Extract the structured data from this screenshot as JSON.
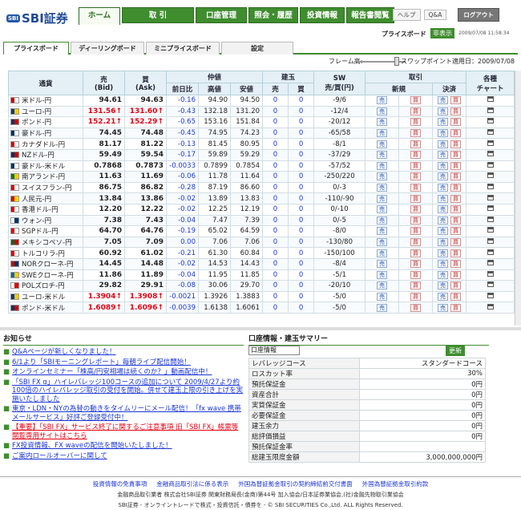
{
  "app": {
    "logo_mark": "SBI",
    "logo_text": "SBI証券"
  },
  "nav": [
    "ホーム",
    "取 引",
    "口座管理",
    "照会・履歴",
    "投資情報",
    "報告書閲覧"
  ],
  "utils": {
    "help": "ヘルプ",
    "qa": "Q&A",
    "logout": "ログアウト"
  },
  "info": {
    "label": "プライスボード",
    "badge": "非表示",
    "timestamp": "2009/07/08 11:58:34"
  },
  "subtabs": [
    "プライスボード",
    "ディーリングボード",
    "ミニプライスボード",
    "設定"
  ],
  "frame": {
    "label": "フレーム高:",
    "swap": "スワップポイント適用日：2009/07/08"
  },
  "board": {
    "headers": {
      "pair": "通貨",
      "bid": "売\n(Bid)",
      "ask": "買\n(Ask)",
      "mid": "仲値",
      "mid_sub": [
        "前日比",
        "高値",
        "安値"
      ],
      "pos": "建玉",
      "pos_sub": [
        "売",
        "買"
      ],
      "sw": "SW\n売/買(円)",
      "trade": "取引",
      "trade_sub": [
        "新規",
        "決済"
      ],
      "chart": "各種\nチャート"
    },
    "buy": "売",
    "sell": "買",
    "rows": [
      {
        "pair": "米ドル-円",
        "bid": "94.61",
        "ask": "94.63",
        "chg": "-0.16",
        "high": "94.90",
        "low": "94.50",
        "s": "0",
        "b": "0",
        "sw": "-9/6",
        "up": false,
        "flag": [
          "#c00",
          "#fff"
        ]
      },
      {
        "pair": "ユーロ-円",
        "bid": "131.56↑",
        "ask": "131.60↑",
        "chg": "-0.43",
        "high": "132.18",
        "low": "131.20",
        "s": "0",
        "b": "0",
        "sw": "-12/4",
        "up": true,
        "flag": [
          "#039",
          "#fc0"
        ]
      },
      {
        "pair": "ポンド-円",
        "bid": "152.21↑",
        "ask": "152.29↑",
        "chg": "-0.65",
        "high": "153.16",
        "low": "151.84",
        "s": "0",
        "b": "0",
        "sw": "-20/12",
        "up": true,
        "flag": [
          "#036",
          "#c00"
        ]
      },
      {
        "pair": "豪ドル-円",
        "bid": "74.45",
        "ask": "74.48",
        "chg": "-0.45",
        "high": "74.95",
        "low": "74.23",
        "s": "0",
        "b": "0",
        "sw": "-65/58",
        "up": false,
        "flag": [
          "#036",
          "#fff"
        ]
      },
      {
        "pair": "カナダドル-円",
        "bid": "81.17",
        "ask": "81.22",
        "chg": "-0.13",
        "high": "81.45",
        "low": "80.95",
        "s": "0",
        "b": "0",
        "sw": "-8/1",
        "up": false,
        "flag": [
          "#d00",
          "#fff"
        ]
      },
      {
        "pair": "NZドル-円",
        "bid": "59.49",
        "ask": "59.54",
        "chg": "-0.17",
        "high": "59.89",
        "low": "59.29",
        "s": "0",
        "b": "0",
        "sw": "-37/29",
        "up": false,
        "flag": [
          "#036",
          "#c00"
        ]
      },
      {
        "pair": "豪ドル-米ドル",
        "bid": "0.7868",
        "ask": "0.7873",
        "chg": "-0.0033",
        "high": "0.7899",
        "low": "0.7854",
        "s": "0",
        "b": "0",
        "sw": "-57/52",
        "up": false,
        "flag": [
          "#036",
          "#fff"
        ]
      },
      {
        "pair": "南アランド-円",
        "bid": "11.63",
        "ask": "11.69",
        "chg": "-0.06",
        "high": "11.78",
        "low": "11.64",
        "s": "0",
        "b": "0",
        "sw": "-250/220",
        "up": false,
        "flag": [
          "#073",
          "#fc0"
        ]
      },
      {
        "pair": "スイスフラン-円",
        "bid": "86.75",
        "ask": "86.82",
        "chg": "-0.28",
        "high": "87.19",
        "low": "86.60",
        "s": "0",
        "b": "0",
        "sw": "0/-3",
        "up": false,
        "flag": [
          "#d00",
          "#fff"
        ]
      },
      {
        "pair": "人民元-円",
        "bid": "13.84",
        "ask": "13.86",
        "chg": "-0.02",
        "high": "13.89",
        "low": "13.83",
        "s": "0",
        "b": "0",
        "sw": "-110/-90",
        "up": false,
        "flag": [
          "#d00",
          "#fd0"
        ]
      },
      {
        "pair": "香港ドル-円",
        "bid": "12.20",
        "ask": "12.22",
        "chg": "-0.02",
        "high": "12.25",
        "low": "12.19",
        "s": "0",
        "b": "0",
        "sw": "0/-10",
        "up": false,
        "flag": [
          "#d00",
          "#fff"
        ]
      },
      {
        "pair": "ウォン-円",
        "bid": "7.38",
        "ask": "7.43",
        "chg": "-0.04",
        "high": "7.47",
        "low": "7.39",
        "s": "0",
        "b": "0",
        "sw": "0/-5",
        "up": false,
        "flag": [
          "#fff",
          "#036"
        ]
      },
      {
        "pair": "SGPドル-円",
        "bid": "64.70",
        "ask": "64.76",
        "chg": "-0.19",
        "high": "65.02",
        "low": "64.59",
        "s": "0",
        "b": "0",
        "sw": "-8/0",
        "up": false,
        "flag": [
          "#d00",
          "#fff"
        ]
      },
      {
        "pair": "メキシコペソ-円",
        "bid": "7.05",
        "ask": "7.09",
        "chg": "0.00",
        "high": "7.06",
        "low": "7.06",
        "s": "0",
        "b": "0",
        "sw": "-130/80",
        "up": false,
        "flag": [
          "#063",
          "#c00"
        ]
      },
      {
        "pair": "トルコリラ-円",
        "bid": "60.92",
        "ask": "61.02",
        "chg": "-0.21",
        "high": "61.30",
        "low": "60.84",
        "s": "0",
        "b": "0",
        "sw": "-150/100",
        "up": false,
        "flag": [
          "#d00",
          "#fff"
        ]
      },
      {
        "pair": "NORクローネ-円",
        "bid": "14.45",
        "ask": "14.48",
        "chg": "-0.02",
        "high": "14.53",
        "low": "14.43",
        "s": "0",
        "b": "0",
        "sw": "-8/4",
        "up": false,
        "flag": [
          "#c00",
          "#036"
        ]
      },
      {
        "pair": "SWEクローネ-円",
        "bid": "11.86",
        "ask": "11.89",
        "chg": "-0.04",
        "high": "11.95",
        "low": "11.85",
        "s": "0",
        "b": "0",
        "sw": "-5/1",
        "up": false,
        "flag": [
          "#06a",
          "#fc0"
        ]
      },
      {
        "pair": "POLズロチ-円",
        "bid": "29.82",
        "ask": "29.91",
        "chg": "-0.08",
        "high": "30.06",
        "low": "29.70",
        "s": "0",
        "b": "0",
        "sw": "-20/10",
        "up": false,
        "flag": [
          "#fff",
          "#d00"
        ]
      },
      {
        "pair": "ユーロ-米ドル",
        "bid": "1.3904↑",
        "ask": "1.3908↑",
        "chg": "-0.0021",
        "high": "1.3926",
        "low": "1.3883",
        "s": "0",
        "b": "0",
        "sw": "-5/0",
        "up": true,
        "flag": [
          "#039",
          "#fc0"
        ]
      },
      {
        "pair": "ポンド-米ドル",
        "bid": "1.6089↑",
        "ask": "1.6096↑",
        "chg": "-0.0039",
        "high": "1.6138",
        "low": "1.6061",
        "s": "0",
        "b": "0",
        "sw": "-5/0",
        "up": true,
        "flag": [
          "#036",
          "#c00"
        ]
      }
    ]
  },
  "news": {
    "title": "お知らせ",
    "items": [
      {
        "text": "Q&Aページが新しくなりました！",
        "red": false
      },
      {
        "text": "6/1より「SBIモーニングレポート」毎朝ライブ配信開始！",
        "red": false
      },
      {
        "text": "オンラインセミナー「株高/円安相場は続くのか？」動画配信中！",
        "red": false
      },
      {
        "text": "「SBI FX α」ハイレバレッジ100コースの追加について 2009/4/27より約100倍のハイレバレッジ取引の受付を開始。併せて建玉上限の引き上げを実施いたしました",
        "red": false
      },
      {
        "text": "東京・LDN・NYの為替の動きをタイムリーにメール配信！「fx wave 携帯メールサービス」好評ご登録受付中！",
        "red": false
      },
      {
        "text": "【重要】「SBI FX」サービス終了に関するご注意事項 旧「SBI FX」帳票等閲覧専用サイトはこちら",
        "red": true
      },
      {
        "text": "FX投資情報、FX waveの配信を開始いたしました！",
        "red": false
      },
      {
        "text": "ご案内ロールオーバーに関して",
        "red": false
      }
    ]
  },
  "summary": {
    "title": "口座情報・建玉サマリー",
    "select": "口座情報",
    "update": "更新",
    "rows": [
      [
        "レバレッジコース",
        "スタンダードコース"
      ],
      [
        "ロスカット率",
        "30%"
      ],
      [
        "預託保証金",
        "0円"
      ],
      [
        "資産合計",
        "0円"
      ],
      [
        "実質保証金",
        "0円"
      ],
      [
        "必要保証金",
        "0円"
      ],
      [
        "建玉余力",
        "0円"
      ],
      [
        "総評価損益",
        "0円"
      ],
      [
        "預託保証金率",
        ""
      ],
      [
        "総建玉限度金額",
        "3,000,000,000円"
      ]
    ]
  },
  "footer": {
    "links": [
      "投資情報の免責事項",
      "金融商品取引法に係る表示",
      "外国為替証拠金取引の契約締結前交付書面",
      "外国為替証拠金取引約款"
    ],
    "line1": "金融商品取引業者 株式会社SBI証券 関東財務局長(金商)第44号 加入協会/日本証券業協会,(社)金融先物取引業協会",
    "line2": "SBI証券 - オンライントレードで株式・投資信託・債券を - © SBI SECURITIES Co.,Ltd. ALL Rights Reserved."
  }
}
